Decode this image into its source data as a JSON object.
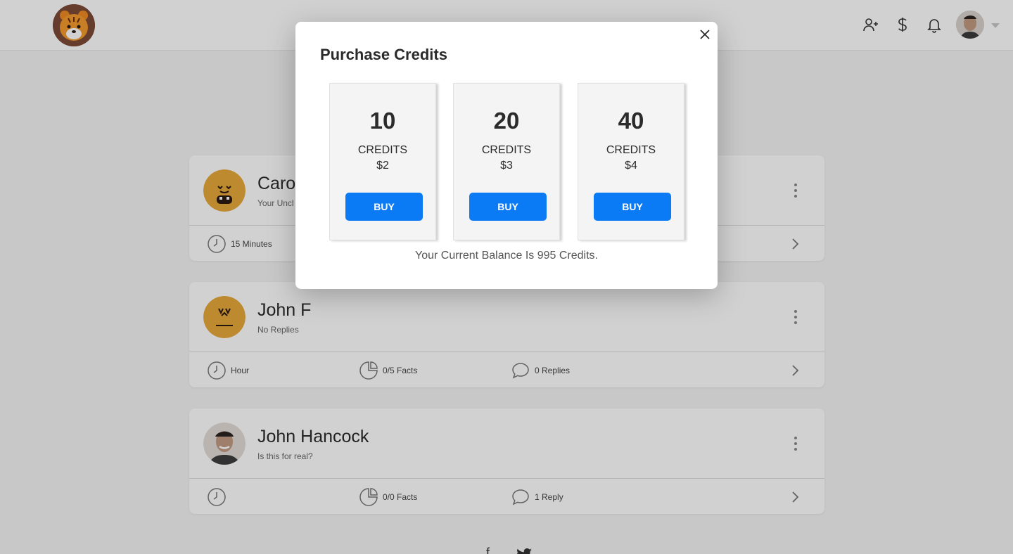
{
  "header": {
    "icons": [
      "add-user-icon",
      "dollar-icon",
      "bell-icon"
    ]
  },
  "posts": [
    {
      "name": "Caro",
      "subtitle": "Your Uncl",
      "time": "15 Minutes"
    },
    {
      "name": "John F",
      "subtitle": "No Replies",
      "time": "Hour",
      "facts": "0/5 Facts",
      "replies": "0 Replies"
    },
    {
      "name": "John Hancock",
      "subtitle": "Is this for real?",
      "time": "",
      "facts": "0/0 Facts",
      "replies": "1 Reply"
    }
  ],
  "social": {
    "facebook": "f"
  },
  "modal": {
    "title": "Purchase Credits",
    "plans": [
      {
        "amount": "10",
        "label": "CREDITS",
        "price": "$2",
        "button": "BUY"
      },
      {
        "amount": "20",
        "label": "CREDITS",
        "price": "$3",
        "button": "BUY"
      },
      {
        "amount": "40",
        "label": "CREDITS",
        "price": "$4",
        "button": "BUY"
      }
    ],
    "balance_text": "Your Current Balance Is 995 Credits."
  },
  "colors": {
    "accent": "#0b7af5",
    "avatar_orange": "#e8a93b"
  }
}
